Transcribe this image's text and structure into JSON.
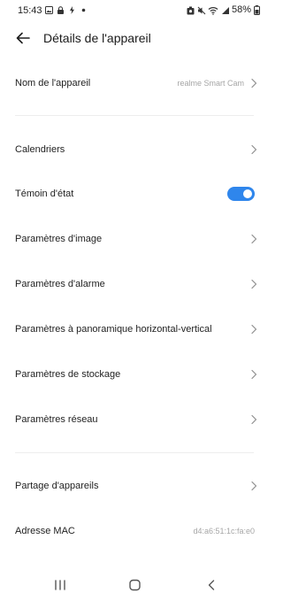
{
  "status_bar": {
    "time": "15:43",
    "battery": "58%",
    "left_icons": [
      "gallery-icon",
      "lock-screen-icon",
      "flash-icon",
      "dot-icon"
    ],
    "right_icons": [
      "camera-privacy-icon",
      "mute-icon",
      "wifi-icon",
      "signal-icon",
      "battery-icon"
    ]
  },
  "header": {
    "title": "Détails de l'appareil",
    "back_icon": "arrow-left-icon"
  },
  "rows": {
    "device_name": {
      "label": "Nom de l'appareil",
      "value": "realme Smart Cam"
    },
    "calendars": {
      "label": "Calendriers"
    },
    "status_light": {
      "label": "Témoin d'état",
      "toggle_on": true
    },
    "image_settings": {
      "label": "Paramètres d'image"
    },
    "alarm_settings": {
      "label": "Paramètres d'alarme"
    },
    "pan_tilt_settings": {
      "label": "Paramètres à panoramique horizontal-vertical"
    },
    "storage_settings": {
      "label": "Paramètres de stockage"
    },
    "network_settings": {
      "label": "Paramètres réseau"
    },
    "device_sharing": {
      "label": "Partage d'appareils"
    },
    "mac_address": {
      "label": "Adresse MAC",
      "value": "d4:a6:51:1c:fa:e0"
    }
  },
  "colors": {
    "accent": "#2f86ec",
    "text": "#1f1f1f",
    "secondary_text": "#a6a6a6",
    "divider": "#ededed"
  },
  "nav_bar": {
    "icons": [
      "recent-apps-icon",
      "home-icon",
      "back-icon"
    ]
  }
}
